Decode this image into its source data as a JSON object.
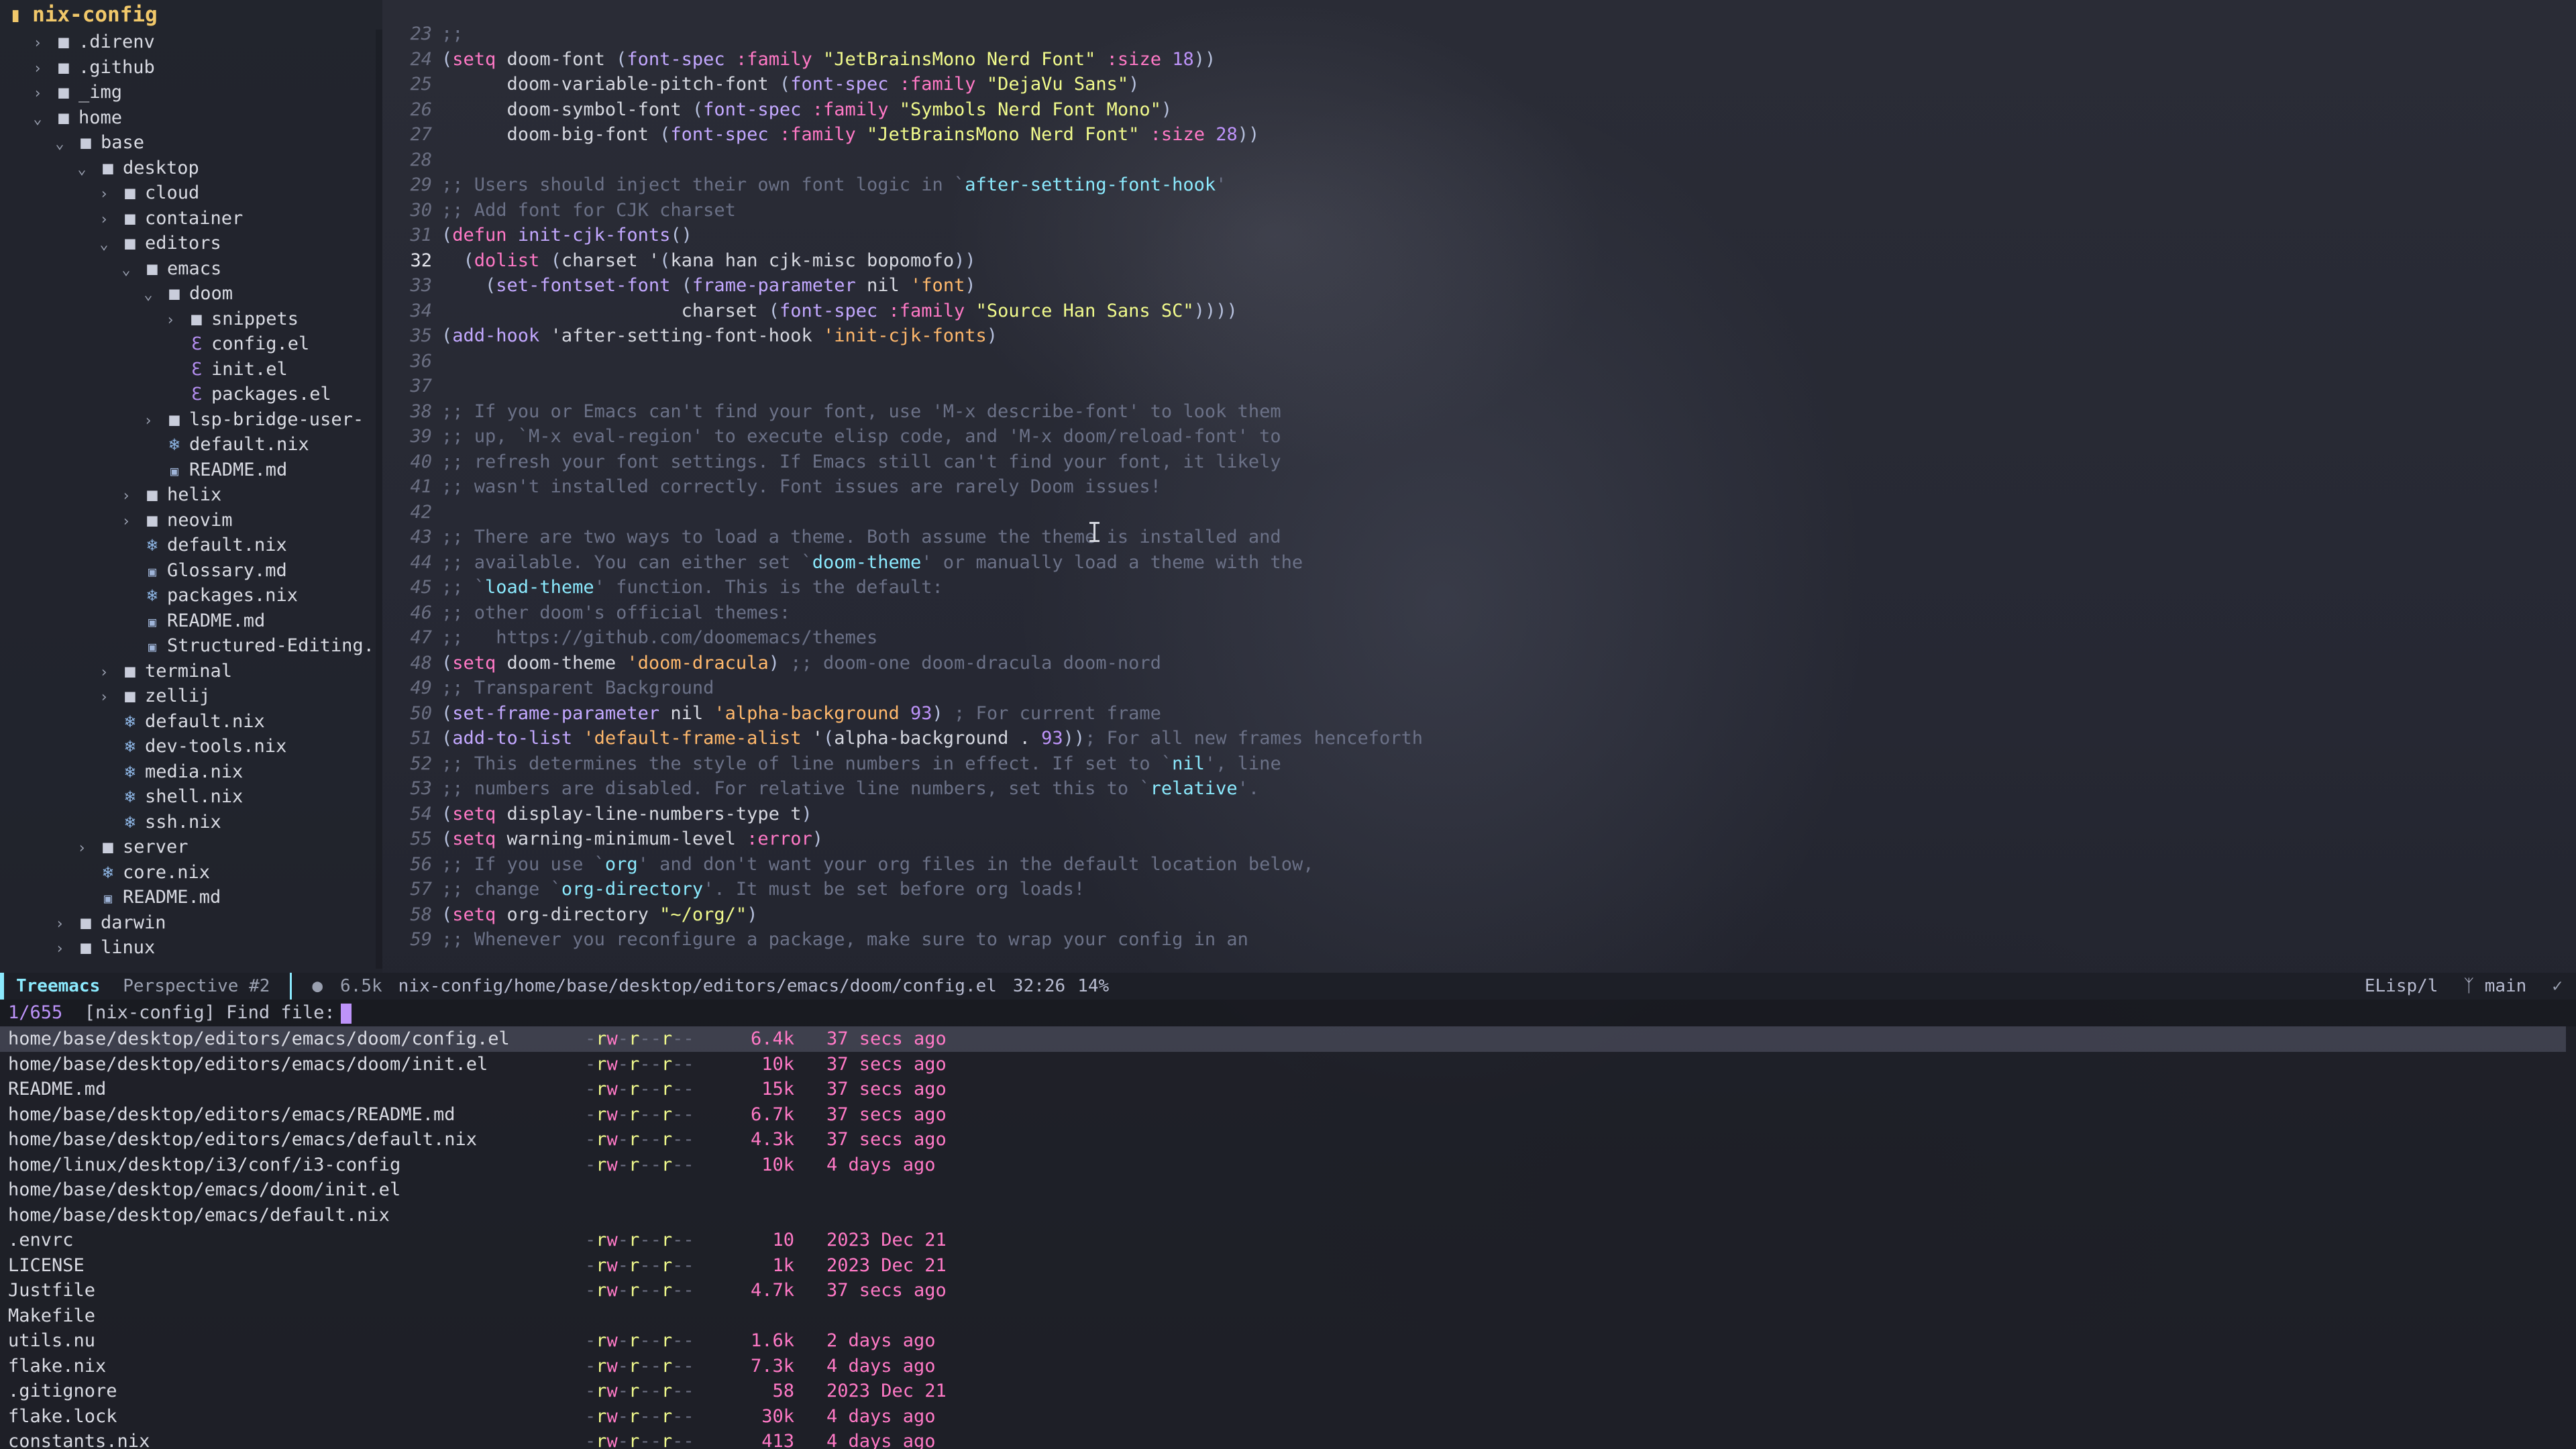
{
  "window": {
    "title": "nix-config"
  },
  "sidebar": {
    "items": [
      {
        "depth": 1,
        "type": "folder",
        "open": false,
        "label": ".direnv"
      },
      {
        "depth": 1,
        "type": "folder",
        "open": false,
        "label": ".github"
      },
      {
        "depth": 1,
        "type": "folder",
        "open": false,
        "label": "_img"
      },
      {
        "depth": 1,
        "type": "folder",
        "open": true,
        "label": "home"
      },
      {
        "depth": 2,
        "type": "folder",
        "open": true,
        "label": "base"
      },
      {
        "depth": 3,
        "type": "folder",
        "open": true,
        "label": "desktop"
      },
      {
        "depth": 4,
        "type": "folder",
        "open": false,
        "label": "cloud"
      },
      {
        "depth": 4,
        "type": "folder",
        "open": false,
        "label": "container"
      },
      {
        "depth": 4,
        "type": "folder",
        "open": true,
        "label": "editors"
      },
      {
        "depth": 5,
        "type": "folder",
        "open": true,
        "label": "emacs"
      },
      {
        "depth": 6,
        "type": "folder",
        "open": true,
        "label": "doom"
      },
      {
        "depth": 7,
        "type": "folder",
        "open": false,
        "label": "snippets"
      },
      {
        "depth": 7,
        "type": "elisp",
        "label": "config.el"
      },
      {
        "depth": 7,
        "type": "elisp",
        "label": "init.el"
      },
      {
        "depth": 7,
        "type": "elisp",
        "label": "packages.el"
      },
      {
        "depth": 6,
        "type": "folder",
        "open": false,
        "label": "lsp-bridge-user-"
      },
      {
        "depth": 6,
        "type": "nix",
        "label": "default.nix"
      },
      {
        "depth": 6,
        "type": "md",
        "label": "README.md"
      },
      {
        "depth": 5,
        "type": "folder",
        "open": false,
        "label": "helix"
      },
      {
        "depth": 5,
        "type": "folder",
        "open": false,
        "label": "neovim"
      },
      {
        "depth": 5,
        "type": "nix",
        "label": "default.nix"
      },
      {
        "depth": 5,
        "type": "md",
        "label": "Glossary.md"
      },
      {
        "depth": 5,
        "type": "nix",
        "label": "packages.nix"
      },
      {
        "depth": 5,
        "type": "md",
        "label": "README.md"
      },
      {
        "depth": 5,
        "type": "md",
        "label": "Structured-Editing."
      },
      {
        "depth": 4,
        "type": "folder",
        "open": false,
        "label": "terminal"
      },
      {
        "depth": 4,
        "type": "folder",
        "open": false,
        "label": "zellij"
      },
      {
        "depth": 4,
        "type": "nix",
        "label": "default.nix"
      },
      {
        "depth": 4,
        "type": "nix",
        "label": "dev-tools.nix"
      },
      {
        "depth": 4,
        "type": "nix",
        "label": "media.nix"
      },
      {
        "depth": 4,
        "type": "nix",
        "label": "shell.nix"
      },
      {
        "depth": 4,
        "type": "nix",
        "label": "ssh.nix"
      },
      {
        "depth": 3,
        "type": "folder",
        "open": false,
        "label": "server"
      },
      {
        "depth": 3,
        "type": "nix",
        "label": "core.nix"
      },
      {
        "depth": 3,
        "type": "md",
        "label": "README.md"
      },
      {
        "depth": 2,
        "type": "folder",
        "open": false,
        "label": "darwin"
      },
      {
        "depth": 2,
        "type": "folder",
        "open": false,
        "label": "linux"
      }
    ]
  },
  "editor": {
    "current_line": 32,
    "lines": [
      {
        "n": 23,
        "tokens": [
          [
            "c",
            ";;"
          ]
        ]
      },
      {
        "n": 24,
        "tokens": [
          [
            "p",
            "("
          ],
          [
            "k",
            "setq"
          ],
          [
            "d",
            " doom-font "
          ],
          [
            "p",
            "("
          ],
          [
            "f",
            "font-spec"
          ],
          [
            "d",
            " "
          ],
          [
            "k",
            ":family"
          ],
          [
            "d",
            " "
          ],
          [
            "s",
            "\"JetBrainsMono Nerd Font\""
          ],
          [
            "d",
            " "
          ],
          [
            "k",
            ":size"
          ],
          [
            "d",
            " "
          ],
          [
            "n",
            "18"
          ],
          [
            "p",
            "))"
          ]
        ]
      },
      {
        "n": 25,
        "tokens": [
          [
            "d",
            "      doom-variable-pitch-font "
          ],
          [
            "p",
            "("
          ],
          [
            "f",
            "font-spec"
          ],
          [
            "d",
            " "
          ],
          [
            "k",
            ":family"
          ],
          [
            "d",
            " "
          ],
          [
            "s",
            "\"DejaVu Sans\""
          ],
          [
            "p",
            ")"
          ]
        ]
      },
      {
        "n": 26,
        "tokens": [
          [
            "d",
            "      doom-symbol-font "
          ],
          [
            "p",
            "("
          ],
          [
            "f",
            "font-spec"
          ],
          [
            "d",
            " "
          ],
          [
            "k",
            ":family"
          ],
          [
            "d",
            " "
          ],
          [
            "s",
            "\"Symbols Nerd Font Mono\""
          ],
          [
            "p",
            ")"
          ]
        ]
      },
      {
        "n": 27,
        "tokens": [
          [
            "d",
            "      doom-big-font "
          ],
          [
            "p",
            "("
          ],
          [
            "f",
            "font-spec"
          ],
          [
            "d",
            " "
          ],
          [
            "k",
            ":family"
          ],
          [
            "d",
            " "
          ],
          [
            "s",
            "\"JetBrainsMono Nerd Font\""
          ],
          [
            "d",
            " "
          ],
          [
            "k",
            ":size"
          ],
          [
            "d",
            " "
          ],
          [
            "n",
            "28"
          ],
          [
            "p",
            "))"
          ]
        ]
      },
      {
        "n": 28,
        "tokens": []
      },
      {
        "n": 29,
        "tokens": [
          [
            "c",
            ";; Users should inject their own font logic in `"
          ],
          [
            "l",
            "after-setting-font-hook"
          ],
          [
            "c",
            "'"
          ]
        ]
      },
      {
        "n": 30,
        "tokens": [
          [
            "c",
            ";; Add font for CJK charset"
          ]
        ]
      },
      {
        "n": 31,
        "tokens": [
          [
            "p",
            "("
          ],
          [
            "k",
            "defun"
          ],
          [
            "d",
            " "
          ],
          [
            "f",
            "init-cjk-fonts"
          ],
          [
            "p",
            "()"
          ]
        ]
      },
      {
        "n": 32,
        "tokens": [
          [
            "d",
            "  "
          ],
          [
            "p",
            "("
          ],
          [
            "k",
            "dolist"
          ],
          [
            "d",
            " "
          ],
          [
            "p",
            "("
          ],
          [
            "d",
            "charset '"
          ],
          [
            "p",
            "("
          ],
          [
            "d",
            "kana han cjk-misc bopomofo"
          ],
          [
            "p",
            "))"
          ]
        ]
      },
      {
        "n": 33,
        "tokens": [
          [
            "d",
            "    "
          ],
          [
            "p",
            "("
          ],
          [
            "f",
            "set-fontset-font"
          ],
          [
            "d",
            " "
          ],
          [
            "p",
            "("
          ],
          [
            "f",
            "frame-parameter"
          ],
          [
            "d",
            " nil "
          ],
          [
            "y",
            "'font"
          ],
          [
            "p",
            ")"
          ]
        ]
      },
      {
        "n": 34,
        "tokens": [
          [
            "d",
            "                      charset "
          ],
          [
            "p",
            "("
          ],
          [
            "f",
            "font-spec"
          ],
          [
            "d",
            " "
          ],
          [
            "k",
            ":family"
          ],
          [
            "d",
            " "
          ],
          [
            "s",
            "\"Source Han Sans SC\""
          ],
          [
            "p",
            "))))"
          ]
        ]
      },
      {
        "n": 35,
        "tokens": [
          [
            "p",
            "("
          ],
          [
            "f",
            "add-hook"
          ],
          [
            "d",
            " 'after-setting-font-hook "
          ],
          [
            "y",
            "'init-cjk-fonts"
          ],
          [
            "p",
            ")"
          ]
        ]
      },
      {
        "n": 36,
        "tokens": []
      },
      {
        "n": 37,
        "tokens": []
      },
      {
        "n": 38,
        "tokens": [
          [
            "c",
            ";; If you or Emacs can't find your font, use 'M-x describe-font' to look them"
          ]
        ]
      },
      {
        "n": 39,
        "tokens": [
          [
            "c",
            ";; up, `M-x eval-region' to execute elisp code, and 'M-x doom/reload-font' to"
          ]
        ]
      },
      {
        "n": 40,
        "tokens": [
          [
            "c",
            ";; refresh your font settings. If Emacs still can't find your font, it likely"
          ]
        ]
      },
      {
        "n": 41,
        "tokens": [
          [
            "c",
            ";; wasn't installed correctly. Font issues are rarely Doom issues!"
          ]
        ]
      },
      {
        "n": 42,
        "tokens": []
      },
      {
        "n": 43,
        "tokens": [
          [
            "c",
            ";; There are two ways to load a theme. Both assume the theme is installed and"
          ]
        ]
      },
      {
        "n": 44,
        "tokens": [
          [
            "c",
            ";; available. You can either set `"
          ],
          [
            "l",
            "doom-theme"
          ],
          [
            "c",
            "' or manually load a theme with the"
          ]
        ]
      },
      {
        "n": 45,
        "tokens": [
          [
            "c",
            ";; `"
          ],
          [
            "l",
            "load-theme"
          ],
          [
            "c",
            "' function. This is the default:"
          ]
        ]
      },
      {
        "n": 46,
        "tokens": [
          [
            "c",
            ";; other doom's official themes:"
          ]
        ]
      },
      {
        "n": 47,
        "tokens": [
          [
            "c",
            ";;   https://github.com/doomemacs/themes"
          ]
        ]
      },
      {
        "n": 48,
        "tokens": [
          [
            "p",
            "("
          ],
          [
            "k",
            "setq"
          ],
          [
            "d",
            " doom-theme "
          ],
          [
            "y",
            "'doom-dracula"
          ],
          [
            "p",
            ")"
          ],
          [
            "c",
            " ;; doom-one doom-dracula doom-nord"
          ]
        ]
      },
      {
        "n": 49,
        "tokens": [
          [
            "c",
            ";; Transparent Background"
          ]
        ]
      },
      {
        "n": 50,
        "tokens": [
          [
            "p",
            "("
          ],
          [
            "f",
            "set-frame-parameter"
          ],
          [
            "d",
            " nil "
          ],
          [
            "y",
            "'alpha-background"
          ],
          [
            "d",
            " "
          ],
          [
            "n",
            "93"
          ],
          [
            "p",
            ")"
          ],
          [
            "c",
            " ; For current frame"
          ]
        ]
      },
      {
        "n": 51,
        "tokens": [
          [
            "p",
            "("
          ],
          [
            "f",
            "add-to-list"
          ],
          [
            "d",
            " "
          ],
          [
            "y",
            "'default-frame-alist"
          ],
          [
            "d",
            " '"
          ],
          [
            "p",
            "("
          ],
          [
            "d",
            "alpha-background . "
          ],
          [
            "n",
            "93"
          ],
          [
            "p",
            "))"
          ],
          [
            "c",
            "; For all new frames henceforth"
          ]
        ]
      },
      {
        "n": 52,
        "tokens": [
          [
            "c",
            ";; This determines the style of line numbers in effect. If set to `"
          ],
          [
            "l",
            "nil"
          ],
          [
            "c",
            "', line"
          ]
        ]
      },
      {
        "n": 53,
        "tokens": [
          [
            "c",
            ";; numbers are disabled. For relative line numbers, set this to `"
          ],
          [
            "l",
            "relative"
          ],
          [
            "c",
            "'."
          ]
        ]
      },
      {
        "n": 54,
        "tokens": [
          [
            "p",
            "("
          ],
          [
            "k",
            "setq"
          ],
          [
            "d",
            " display-line-numbers-type t"
          ],
          [
            "p",
            ")"
          ]
        ]
      },
      {
        "n": 55,
        "tokens": [
          [
            "p",
            "("
          ],
          [
            "k",
            "setq"
          ],
          [
            "d",
            " warning-minimum-level "
          ],
          [
            "k",
            ":error"
          ],
          [
            "p",
            ")"
          ]
        ]
      },
      {
        "n": 56,
        "tokens": [
          [
            "c",
            ";; If you use `"
          ],
          [
            "l",
            "org"
          ],
          [
            "c",
            "' and don't want your org files in the default location below,"
          ]
        ]
      },
      {
        "n": 57,
        "tokens": [
          [
            "c",
            ";; change `"
          ],
          [
            "l",
            "org-directory"
          ],
          [
            "c",
            "'. It must be set before org loads!"
          ]
        ]
      },
      {
        "n": 58,
        "tokens": [
          [
            "p",
            "("
          ],
          [
            "k",
            "setq"
          ],
          [
            "d",
            " org-directory "
          ],
          [
            "s",
            "\"~/org/\""
          ],
          [
            "p",
            ")"
          ]
        ]
      },
      {
        "n": 59,
        "tokens": [
          [
            "c",
            ";; Whenever you reconfigure a package, make sure to wrap your config in an"
          ]
        ]
      }
    ]
  },
  "modeline": {
    "tab": "Treemacs",
    "perspective": "Perspective #2",
    "file_size": "6.5k",
    "file_path": "nix-config/home/base/desktop/editors/emacs/doom/config.el",
    "position": "32:26",
    "percent": "14%",
    "major_mode": "ELisp/l",
    "branch": "main"
  },
  "minibuffer": {
    "count": "1/655",
    "prompt": "[nix-config] Find file:"
  },
  "completions": [
    {
      "name": "home/base/desktop/editors/emacs/doom/config.el",
      "perm": "-rw-r--r--",
      "size": "6.4k",
      "time": "37 secs ago",
      "selected": true
    },
    {
      "name": "home/base/desktop/editors/emacs/doom/init.el",
      "perm": "-rw-r--r--",
      "size": "10k",
      "time": "37 secs ago"
    },
    {
      "name": "README.md",
      "perm": "-rw-r--r--",
      "size": "15k",
      "time": "37 secs ago"
    },
    {
      "name": "home/base/desktop/editors/emacs/README.md",
      "perm": "-rw-r--r--",
      "size": "6.7k",
      "time": "37 secs ago"
    },
    {
      "name": "home/base/desktop/editors/emacs/default.nix",
      "perm": "-rw-r--r--",
      "size": "4.3k",
      "time": "37 secs ago"
    },
    {
      "name": "home/linux/desktop/i3/conf/i3-config",
      "perm": "-rw-r--r--",
      "size": "10k",
      "time": "4 days ago"
    },
    {
      "name": "home/base/desktop/emacs/doom/init.el",
      "perm": "",
      "size": "",
      "time": ""
    },
    {
      "name": "home/base/desktop/emacs/default.nix",
      "perm": "",
      "size": "",
      "time": ""
    },
    {
      "name": ".envrc",
      "perm": "-rw-r--r--",
      "size": "10",
      "time": "2023 Dec 21"
    },
    {
      "name": "LICENSE",
      "perm": "-rw-r--r--",
      "size": "1k",
      "time": "2023 Dec 21"
    },
    {
      "name": "Justfile",
      "perm": "-rw-r--r--",
      "size": "4.7k",
      "time": "37 secs ago"
    },
    {
      "name": "Makefile",
      "perm": "",
      "size": "",
      "time": ""
    },
    {
      "name": "utils.nu",
      "perm": "-rw-r--r--",
      "size": "1.6k",
      "time": "2 days ago"
    },
    {
      "name": "flake.nix",
      "perm": "-rw-r--r--",
      "size": "7.3k",
      "time": "4 days ago"
    },
    {
      "name": ".gitignore",
      "perm": "-rw-r--r--",
      "size": "58",
      "time": "2023 Dec 21"
    },
    {
      "name": "flake.lock",
      "perm": "-rw-r--r--",
      "size": "30k",
      "time": "4 days ago"
    },
    {
      "name": "constants.nix",
      "perm": "-rw-r--r--",
      "size": "413",
      "time": "4 days ago"
    }
  ],
  "colors": {
    "accent": "#8be9fd",
    "keyword": "#ff79c6",
    "string": "#f1fa8c",
    "comment": "#6b7187",
    "title": "#f1c86a"
  }
}
